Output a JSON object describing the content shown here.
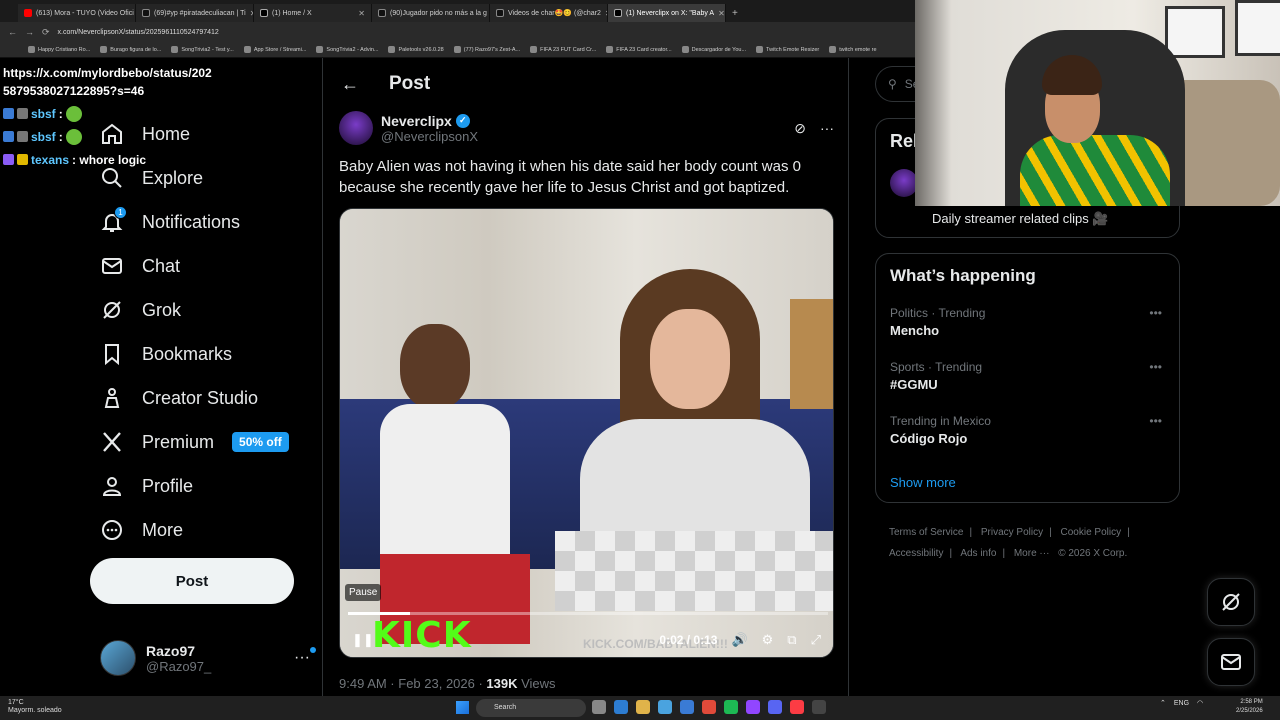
{
  "browser": {
    "tabs": [
      {
        "label": "(613) Mora - TUYO (Video Ofici",
        "color": "#ff0000"
      },
      {
        "label": "(69)#yp #piratadeculiacan | Ti",
        "color": "#ffffff"
      },
      {
        "label": "(1) Home / X",
        "color": "#ffffff"
      },
      {
        "label": "(90)Jugador pido no más a la g",
        "color": "#ffffff"
      },
      {
        "label": "Videos de char🤩😊 (@char2",
        "color": "#ffffff"
      },
      {
        "label": "(1) Neverclipx on X: \"Baby A",
        "color": "#ffffff"
      }
    ],
    "address": "x.com/NeverclipsonX/status/2025961110524797412",
    "bookmarks": [
      "Happy Cristiano Ro...",
      "Burago figura de lo...",
      "SongTrivia2 - Test y...",
      "App Store / Streami...",
      "SongTrivia2 - Advin...",
      "Paletools v26.0.28",
      "(77) Razo97's Zest-A...",
      "FIFA 23 FUT Card Cr...",
      "FIFA 23 Card creator...",
      "Descargador de You...",
      "Twitch Emote Resizer",
      "twitch emote re"
    ]
  },
  "overlay": {
    "url": "https://x.com/mylordbebo/status/2025879538027122895?s=46",
    "messages": [
      {
        "user": "sbsf",
        "text": ":"
      },
      {
        "user": "sbsf",
        "text": ":"
      },
      {
        "user": "texans",
        "text": ": whore logic"
      }
    ]
  },
  "nav": {
    "home": "Home",
    "explore": "Explore",
    "notifications": "Notifications",
    "notifications_count": "1",
    "chat": "Chat",
    "grok": "Grok",
    "bookmarks": "Bookmarks",
    "creator_studio": "Creator Studio",
    "premium": "Premium",
    "premium_badge": "50% off",
    "profile": "Profile",
    "more": "More",
    "post_button": "Post",
    "account_name": "Razo97",
    "account_handle": "@Razo97_"
  },
  "post": {
    "header_title": "Post",
    "author_name": "Neverclipx",
    "author_handle": "@NeverclipsonX",
    "text": "Baby Alien was not having it when his date said her body count was 0 because she recently gave her life to Jesus Christ and got baptized.",
    "video": {
      "pause_label": "Pause",
      "time": "0:02 / 0:13",
      "watermark": "KICK",
      "watermark_url": "KICK.COM/BABYALIEN!!!",
      "progress": 0.13
    },
    "timestamp": "9:49 AM · Feb 23, 2026 · ",
    "views_count": "139K",
    "views_label": " Views"
  },
  "right": {
    "search_placeholder": "Se",
    "relevant_title": "Rel",
    "relevant_bio": "Daily streamer related clips 🎥",
    "happening_title": "What’s happening",
    "trends": [
      {
        "context": "Politics · Trending",
        "name": "Mencho"
      },
      {
        "context": "Sports · Trending",
        "name": "#GGMU"
      },
      {
        "context": "Trending in Mexico",
        "name": "Código Rojo"
      }
    ],
    "show_more": "Show more",
    "footer": [
      "Terms of Service",
      "|",
      "Privacy Policy",
      "|",
      "Cookie Policy",
      "|",
      "Accessibility",
      "|",
      "Ads info",
      "|",
      "More ···",
      "© 2026 X Corp."
    ]
  },
  "taskbar": {
    "weather_temp": "17°C",
    "weather_desc": "Mayorm. soleado",
    "search": "Search",
    "lang": "ENG",
    "time": "2:58 PM",
    "date": "2/25/2026"
  },
  "colors": {
    "accent": "#1d9bf0",
    "kick": "#53fc18"
  }
}
